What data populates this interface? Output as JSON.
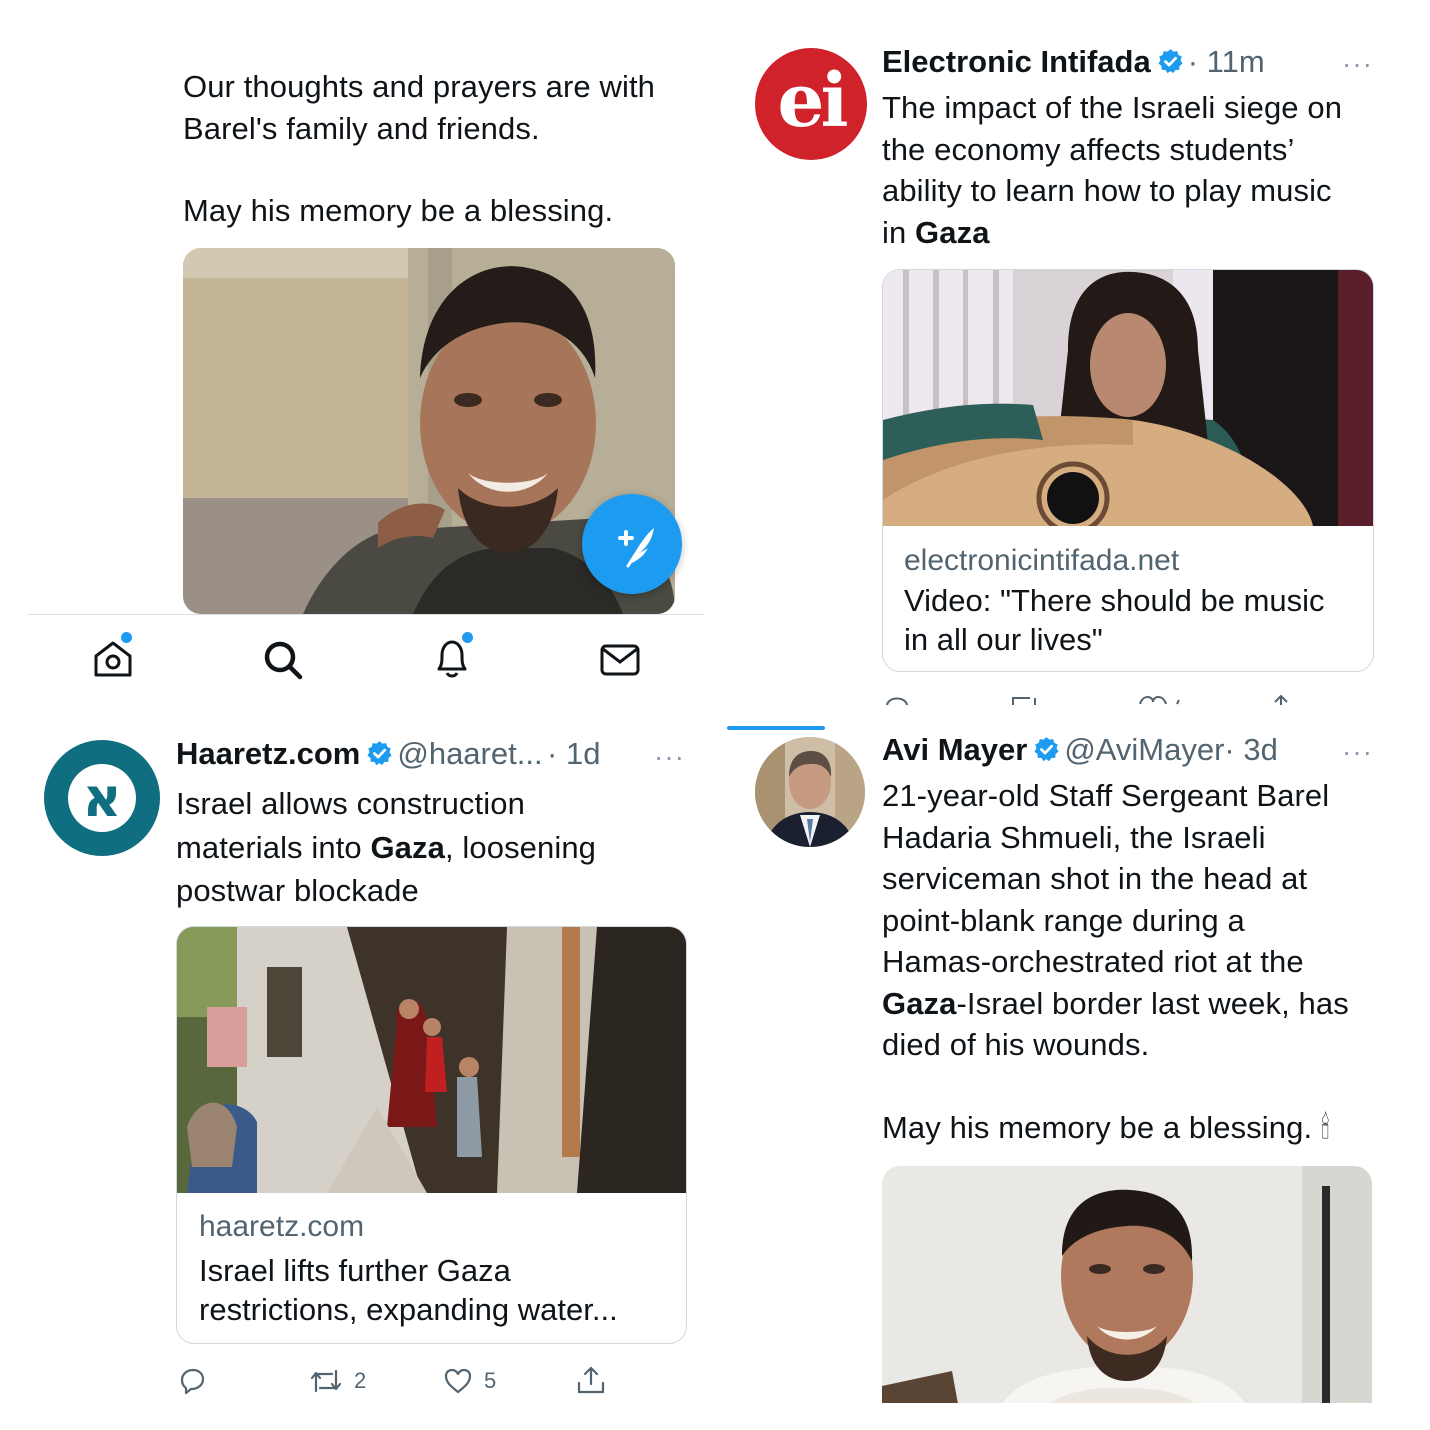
{
  "colors": {
    "twitter_blue": "#1d9bf0",
    "text": "#0f1419",
    "secondary_text": "#536471",
    "divider": "#eff3f4",
    "ei_red": "#d0222b",
    "haaretz_teal": "#0f6e7f"
  },
  "panel_top_left": {
    "text_line1": "Our thoughts and prayers are with",
    "text_line2": "Barel's family and friends.",
    "text_line3": "May his memory be a blessing.",
    "compose_icon": "feather-plus-icon",
    "nav": [
      {
        "icon": "home-icon",
        "has_dot": true
      },
      {
        "icon": "search-icon",
        "has_dot": false
      },
      {
        "icon": "bell-icon",
        "has_dot": true
      },
      {
        "icon": "mail-icon",
        "has_dot": false
      }
    ]
  },
  "tweet_ei": {
    "avatar_text": "ei",
    "name": "Electronic Intifada",
    "time": "· 11m",
    "more": "···",
    "text_l1": "The impact of the Israeli siege on",
    "text_l2": "the economy affects students’",
    "text_l3": "ability to learn how to play music",
    "text_l4_pre": "in ",
    "text_l4_bold": "Gaza",
    "card_domain": "electronicintifada.net",
    "card_title_l1": "Video: \"There should be music",
    "card_title_l2": "in all our lives\""
  },
  "tweet_haaretz": {
    "avatar_letter": "א",
    "name": "Haaretz.com",
    "handle": "@haaret...",
    "time": "· 1d",
    "more": "···",
    "text_l1": "Israel allows construction",
    "text_l2_pre": "materials into ",
    "text_l2_bold": "Gaza",
    "text_l2_post": ", loosening",
    "text_l3": "postwar blockade",
    "card_domain": "haaretz.com",
    "card_title_l1": "Israel lifts further Gaza",
    "card_title_l2": "restrictions, expanding water...",
    "actions": {
      "reply_count": "",
      "retweet_count": "2",
      "like_count": "5"
    }
  },
  "tweet_avi": {
    "name": "Avi Mayer",
    "handle": "@AviMayer",
    "time": "· 3d",
    "more": "···",
    "text_l1": "21-year-old Staff Sergeant Barel",
    "text_l2": "Hadaria Shmueli, the Israeli",
    "text_l3": "serviceman shot in the head at",
    "text_l4": "point-blank range during a",
    "text_l5": "Hamas-orchestrated riot at the",
    "text_l6_bold": "Gaza",
    "text_l6_post": "-Israel border last week, has",
    "text_l7": "died of his wounds.",
    "text_l8": "May his memory be a blessing. 🕯"
  }
}
